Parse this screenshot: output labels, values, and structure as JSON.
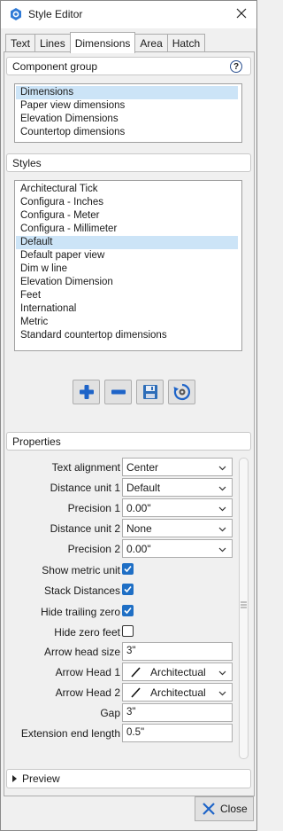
{
  "window": {
    "title": "Style Editor"
  },
  "tabs": [
    {
      "label": "Text",
      "active": false
    },
    {
      "label": "Lines",
      "active": false
    },
    {
      "label": "Dimensions",
      "active": true
    },
    {
      "label": "Area",
      "active": false
    },
    {
      "label": "Hatch",
      "active": false
    }
  ],
  "component_group": {
    "header": "Component group",
    "help_label": "?",
    "items": [
      "Dimensions",
      "Paper view dimensions",
      "Elevation Dimensions",
      "Countertop dimensions"
    ],
    "selected": "Dimensions"
  },
  "styles": {
    "header": "Styles",
    "items": [
      "Architectural Tick",
      "Configura - Inches",
      "Configura - Meter",
      "Configura - Millimeter",
      "Default",
      "Default paper view",
      "Dim w line",
      "Elevation Dimension",
      "Feet",
      "International",
      "Metric",
      "Standard countertop dimensions"
    ],
    "selected": "Default",
    "buttons": [
      "add-icon",
      "remove-icon",
      "save-icon",
      "reset-icon"
    ]
  },
  "properties": {
    "header": "Properties",
    "text_alignment": {
      "label": "Text alignment",
      "value": "Center"
    },
    "distance_unit_1": {
      "label": "Distance unit 1",
      "value": "Default"
    },
    "precision_1": {
      "label": "Precision 1",
      "value": "0.00\""
    },
    "distance_unit_2": {
      "label": "Distance unit 2",
      "value": "None"
    },
    "precision_2": {
      "label": "Precision 2",
      "value": "0.00\""
    },
    "show_metric_unit": {
      "label": "Show metric unit",
      "checked": true
    },
    "stack_distances": {
      "label": "Stack Distances",
      "checked": true
    },
    "hide_trailing_zero": {
      "label": "Hide trailing zero",
      "checked": true
    },
    "hide_zero_feet": {
      "label": "Hide zero feet",
      "checked": false
    },
    "arrow_head_size": {
      "label": "Arrow head size",
      "value": "3\""
    },
    "arrow_head_1": {
      "label": "Arrow Head 1",
      "value": "Architectual"
    },
    "arrow_head_2": {
      "label": "Arrow Head 2",
      "value": "Architectual"
    },
    "gap": {
      "label": "Gap",
      "value": "3\""
    },
    "extension_end_length": {
      "label": "Extension end length",
      "value": "0.5\""
    }
  },
  "preview": {
    "label": "Preview"
  },
  "footer": {
    "close_label": "Close"
  },
  "colors": {
    "accent": "#1f6fc5",
    "selection": "#cce4f7"
  }
}
